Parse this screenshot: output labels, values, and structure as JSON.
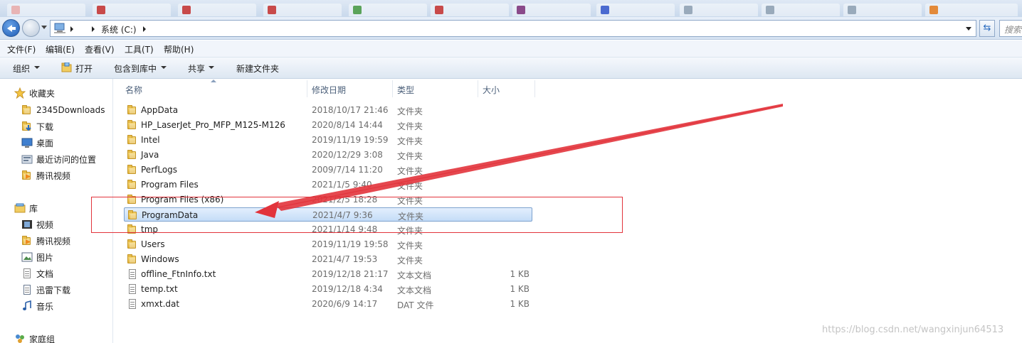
{
  "address": {
    "path_label": "系统 (C:)",
    "search_placeholder": "搜索"
  },
  "menu": [
    "文件(F)",
    "编辑(E)",
    "查看(V)",
    "工具(T)",
    "帮助(H)"
  ],
  "toolbar": {
    "organize": "组织",
    "open": "打开",
    "include_library": "包含到库中",
    "share": "共享",
    "new_folder": "新建文件夹"
  },
  "nav": {
    "favorites_label": "收藏夹",
    "favorites": [
      "2345Downloads",
      "下载",
      "桌面",
      "最近访问的位置",
      "腾讯视频"
    ],
    "libraries_label": "库",
    "libraries": [
      "视频",
      "腾讯视频",
      "图片",
      "文档",
      "迅雷下载",
      "音乐"
    ],
    "homegroup_label": "家庭组"
  },
  "columns": {
    "name": "名称",
    "modified": "修改日期",
    "type": "类型",
    "size": "大小"
  },
  "files": [
    {
      "name": "AppData",
      "date": "2018/10/17 21:46",
      "type": "文件夹",
      "size": "",
      "kind": "folder"
    },
    {
      "name": "HP_LaserJet_Pro_MFP_M125-M126",
      "date": "2020/8/14 14:44",
      "type": "文件夹",
      "size": "",
      "kind": "folder"
    },
    {
      "name": "Intel",
      "date": "2019/11/19 19:59",
      "type": "文件夹",
      "size": "",
      "kind": "folder"
    },
    {
      "name": "Java",
      "date": "2020/12/29 3:08",
      "type": "文件夹",
      "size": "",
      "kind": "folder"
    },
    {
      "name": "PerfLogs",
      "date": "2009/7/14 11:20",
      "type": "文件夹",
      "size": "",
      "kind": "folder"
    },
    {
      "name": "Program Files",
      "date": "2021/1/5 9:40",
      "type": "文件夹",
      "size": "",
      "kind": "folder"
    },
    {
      "name": "Program Files (x86)",
      "date": "2021/2/5 18:28",
      "type": "文件夹",
      "size": "",
      "kind": "folder"
    },
    {
      "name": "ProgramData",
      "date": "2021/4/7 9:36",
      "type": "文件夹",
      "size": "",
      "kind": "folder",
      "selected": true
    },
    {
      "name": "tmp",
      "date": "2021/1/14 9:48",
      "type": "文件夹",
      "size": "",
      "kind": "folder"
    },
    {
      "name": "Users",
      "date": "2019/11/19 19:58",
      "type": "文件夹",
      "size": "",
      "kind": "folder"
    },
    {
      "name": "Windows",
      "date": "2021/4/7 19:53",
      "type": "文件夹",
      "size": "",
      "kind": "folder"
    },
    {
      "name": "offline_FtnInfo.txt",
      "date": "2019/12/18 21:17",
      "type": "文本文档",
      "size": "1 KB",
      "kind": "text"
    },
    {
      "name": "temp.txt",
      "date": "2019/12/18 4:34",
      "type": "文本文档",
      "size": "1 KB",
      "kind": "text"
    },
    {
      "name": "xmxt.dat",
      "date": "2020/6/9 14:17",
      "type": "DAT 文件",
      "size": "1 KB",
      "kind": "dat"
    }
  ],
  "watermark": "https://blog.csdn.net/wangxinjun64513",
  "colors": {
    "selection_border": "#7da2ce",
    "annotation_red": "#e2343c"
  }
}
